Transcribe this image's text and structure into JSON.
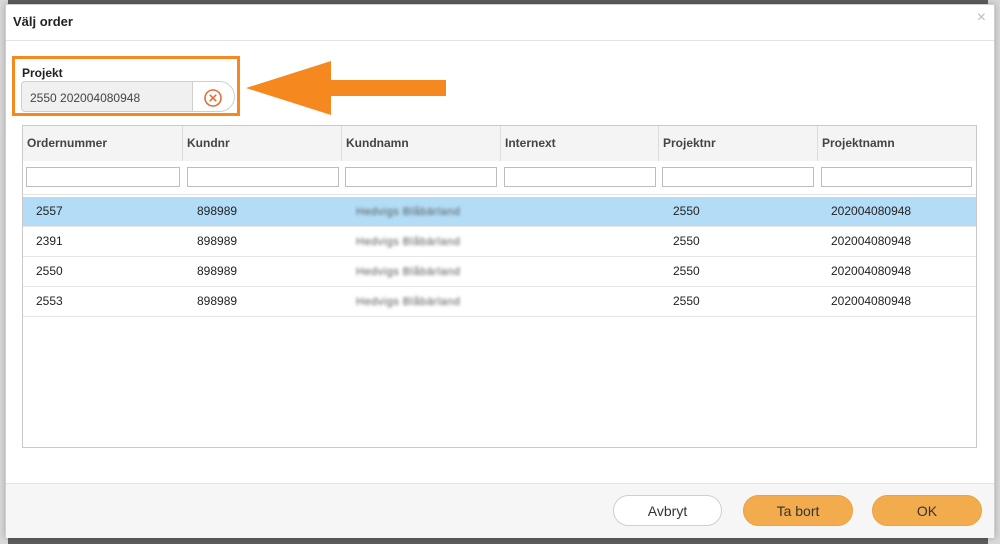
{
  "dialog": {
    "title": "Välj order",
    "close_glyph": "×"
  },
  "project_field": {
    "label": "Projekt",
    "value": "2550 202004080948",
    "clear_icon": "clear-circle-icon"
  },
  "annotation": {
    "arrow_color": "#f5891f"
  },
  "grid": {
    "columns": [
      "Ordernummer",
      "Kundnr",
      "Kundnamn",
      "Internext",
      "Projektnr",
      "Projektnamn"
    ],
    "rows": [
      [
        "2557",
        "898989",
        "Hedvigs Blåbärland",
        "",
        "2550",
        "202004080948"
      ],
      [
        "2391",
        "898989",
        "Hedvigs Blåbärland",
        "",
        "2550",
        "202004080948"
      ],
      [
        "2550",
        "898989",
        "Hedvigs Blåbärland",
        "",
        "2550",
        "202004080948"
      ],
      [
        "2553",
        "898989",
        "Hedvigs Blåbärland",
        "",
        "2550",
        "202004080948"
      ]
    ]
  },
  "footer": {
    "cancel_label": "Avbryt",
    "delete_label": "Ta bort",
    "ok_label": "OK"
  },
  "colors": {
    "accent": "#f3ac4d",
    "selected_row": "#b3ddf7",
    "highlight": "#f5891f"
  }
}
